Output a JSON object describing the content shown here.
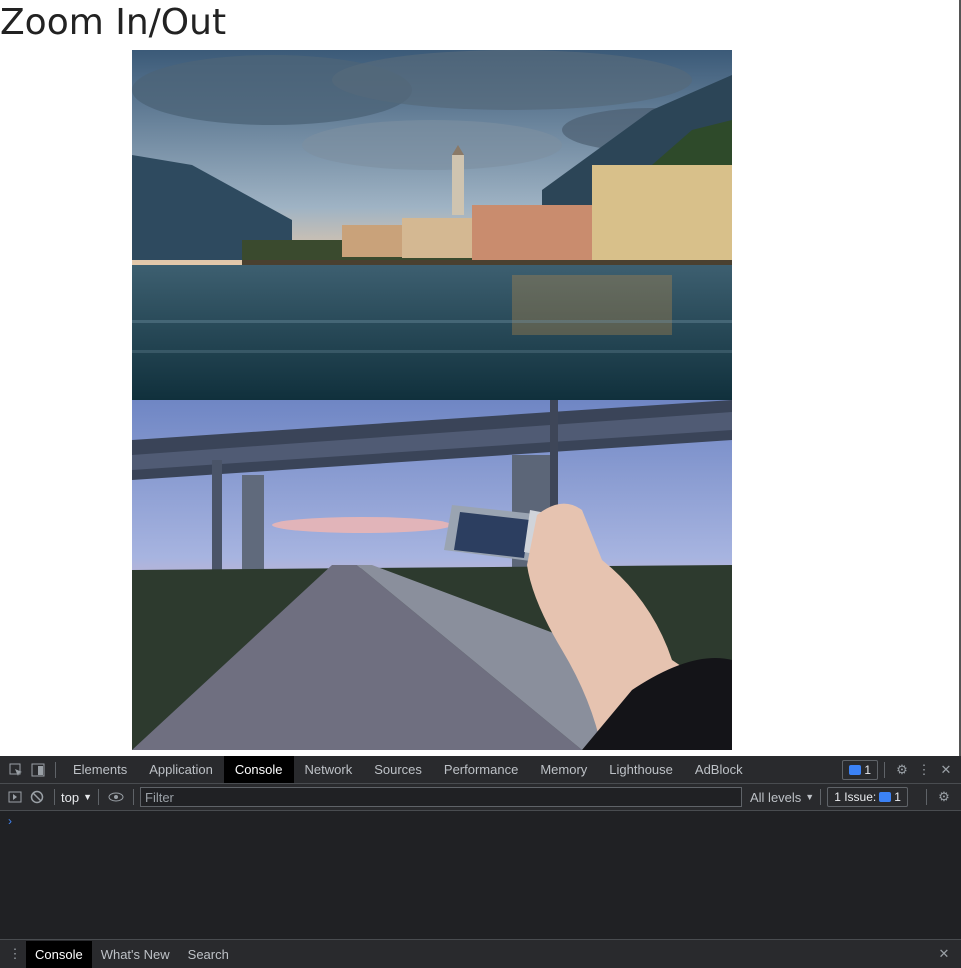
{
  "page": {
    "title": "Zoom In/Out"
  },
  "devtools": {
    "tabs": [
      {
        "label": "Elements"
      },
      {
        "label": "Application"
      },
      {
        "label": "Console"
      },
      {
        "label": "Network"
      },
      {
        "label": "Sources"
      },
      {
        "label": "Performance"
      },
      {
        "label": "Memory"
      },
      {
        "label": "Lighthouse"
      },
      {
        "label": "AdBlock"
      }
    ],
    "active_tab": "Console",
    "message_count": "1",
    "toolbar": {
      "context": "top",
      "filter_placeholder": "Filter",
      "levels": "All levels",
      "issues_label": "1 Issue:",
      "issues_count": "1"
    },
    "prompt_symbol": "›",
    "drawer": {
      "tabs": [
        {
          "label": "Console"
        },
        {
          "label": "What's New"
        },
        {
          "label": "Search"
        }
      ]
    }
  }
}
